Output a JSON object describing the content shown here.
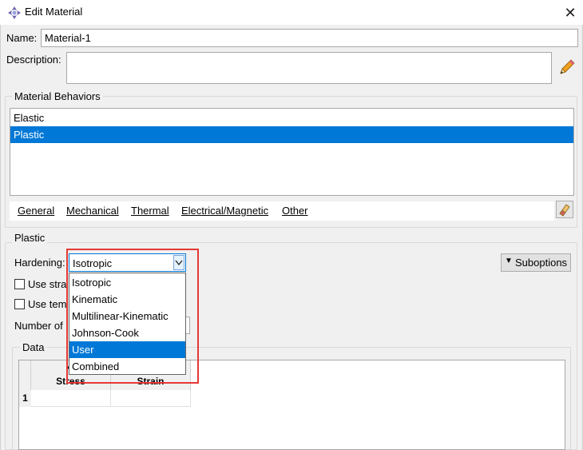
{
  "window": {
    "title": "Edit Material",
    "close_glyph": "✕"
  },
  "name_field": {
    "label": "Name:",
    "value": "Material-1"
  },
  "description_field": {
    "label": "Description:",
    "value": ""
  },
  "behaviors": {
    "group_title": "Material Behaviors",
    "items": [
      {
        "label": "Elastic",
        "selected": false
      },
      {
        "label": "Plastic",
        "selected": true
      }
    ],
    "menu": [
      "General",
      "Mechanical",
      "Thermal",
      "Electrical/Magnetic",
      "Other"
    ]
  },
  "plastic": {
    "group_title": "Plastic",
    "hardening_label": "Hardening:",
    "hardening_value": "Isotropic",
    "options": [
      {
        "label": "Isotropic",
        "selected": false
      },
      {
        "label": "Kinematic",
        "selected": false
      },
      {
        "label": "Multilinear-Kinematic",
        "selected": false
      },
      {
        "label": "Johnson-Cook",
        "selected": false
      },
      {
        "label": "User",
        "selected": true
      },
      {
        "label": "Combined",
        "selected": false
      }
    ],
    "use_strain_label": "Use stra",
    "use_temp_label": "Use tem",
    "number_of_label": "Number of",
    "suboptions_label": "Suboptions",
    "suboptions_arrow": "▼"
  },
  "data": {
    "group_title": "Data",
    "col1_header_line1": "Yi",
    "col1_header_line2": "Stress",
    "col2_header": "Strain",
    "row_number": "1"
  },
  "colors": {
    "accent": "#0078d7",
    "highlight_box": "#e53935",
    "dialog_bg": "#f0f0f0"
  }
}
